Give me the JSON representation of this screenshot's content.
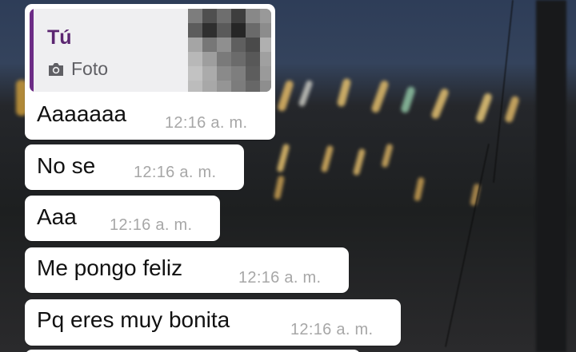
{
  "chat": {
    "reply_quote": {
      "author": "Tú",
      "kind_label": "Foto",
      "kind_icon": "camera-icon"
    },
    "messages": [
      {
        "text": "Aaaaaaa",
        "time": "12:16 a. m."
      },
      {
        "text": "No se",
        "time": "12:16 a. m."
      },
      {
        "text": "Aaa",
        "time": "12:16 a. m."
      },
      {
        "text": "Me pongo feliz",
        "time": "12:16 a. m."
      },
      {
        "text": "Pq eres muy bonita",
        "time": "12:16 a. m."
      }
    ]
  },
  "colors": {
    "bubble": "#ffffff",
    "quote_accent": "#6d2c86",
    "timestamp": "#a7a7a7"
  }
}
